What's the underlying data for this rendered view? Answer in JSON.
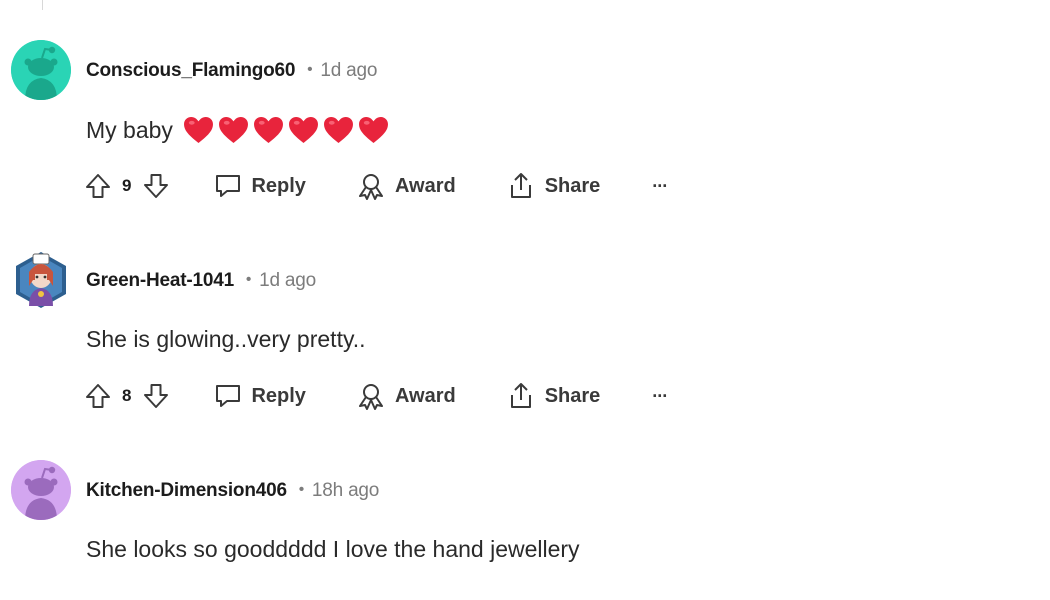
{
  "comments": [
    {
      "author": "Conscious_Flamingo60",
      "time": "1d ago",
      "text": "My baby",
      "emoji_hearts": 6,
      "votes": "9",
      "avatar_color": "#2ad4b5"
    },
    {
      "author": "Green-Heat-1041",
      "time": "1d ago",
      "text": "She is glowing..very pretty..",
      "votes": "8",
      "avatar_color": "#2d5f8f"
    },
    {
      "author": "Kitchen-Dimension406",
      "time": "18h ago",
      "text": "She looks so gooddddd I love the hand jewellery",
      "avatar_color": "#d3a6f0"
    }
  ],
  "actions": {
    "reply": "Reply",
    "award": "Award",
    "share": "Share",
    "more": "···"
  },
  "colors": {
    "heart": "#e8243c",
    "text_secondary": "#7c7c7c",
    "icon": "#3a3a3a"
  }
}
